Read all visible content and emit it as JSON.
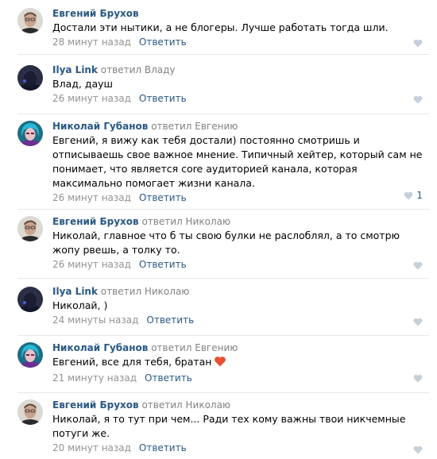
{
  "colors": {
    "link": "#2a5885",
    "meta": "#939393",
    "like_icon": "#c5d0db",
    "divider": "#e7e8ec"
  },
  "reply_label": "Ответить",
  "comments": [
    {
      "avatar": "avatar-evgeny",
      "author": "Евгений Брухов",
      "replied_to": "",
      "text": "Достали эти нытики, а не блогеры. Лучше работать тогда шли.",
      "date": "28 минут назад",
      "likes": ""
    },
    {
      "avatar": "avatar-ilya",
      "author": "Ilya Link",
      "replied_to": "ответил Владу",
      "text": "Влад, дауш",
      "date": "26 минут назад",
      "likes": ""
    },
    {
      "avatar": "avatar-nikolay",
      "author": "Николай Губанов",
      "replied_to": "ответил Евгению",
      "text": "Евгений, я вижу как тебя достали) постоянно смотришь и отписываешь свое важное мнение. Типичный хейтер, который сам не понимает, что является core аудиторией канала, которая максимально помогает жизни канала.",
      "date": "26 минут назад",
      "likes": "1"
    },
    {
      "avatar": "avatar-evgeny",
      "author": "Евгений Брухов",
      "replied_to": "ответил Николаю",
      "text": "Николай, главное что б ты свою булки не раслоблял, а то смотрю жопу рвешь, а толку то.",
      "date": "26 минут назад",
      "likes": ""
    },
    {
      "avatar": "avatar-ilya",
      "author": "Ilya Link",
      "replied_to": "ответил Николаю",
      "text": "Николай, )",
      "date": "24 минуты назад",
      "likes": ""
    },
    {
      "avatar": "avatar-nikolay",
      "author": "Николай Губанов",
      "replied_to": "ответил Евгению",
      "text": "Евгений, все для тебя, братан",
      "date": "21 минуту назад",
      "likes": "",
      "emoji": "heart-emoji"
    },
    {
      "avatar": "avatar-evgeny",
      "author": "Евгений Брухов",
      "replied_to": "ответил Николаю",
      "text": "Николай, я то тут при чем... Ради тех кому важны твои никчемные потуги же.",
      "date": "20 минут назад",
      "likes": ""
    }
  ]
}
